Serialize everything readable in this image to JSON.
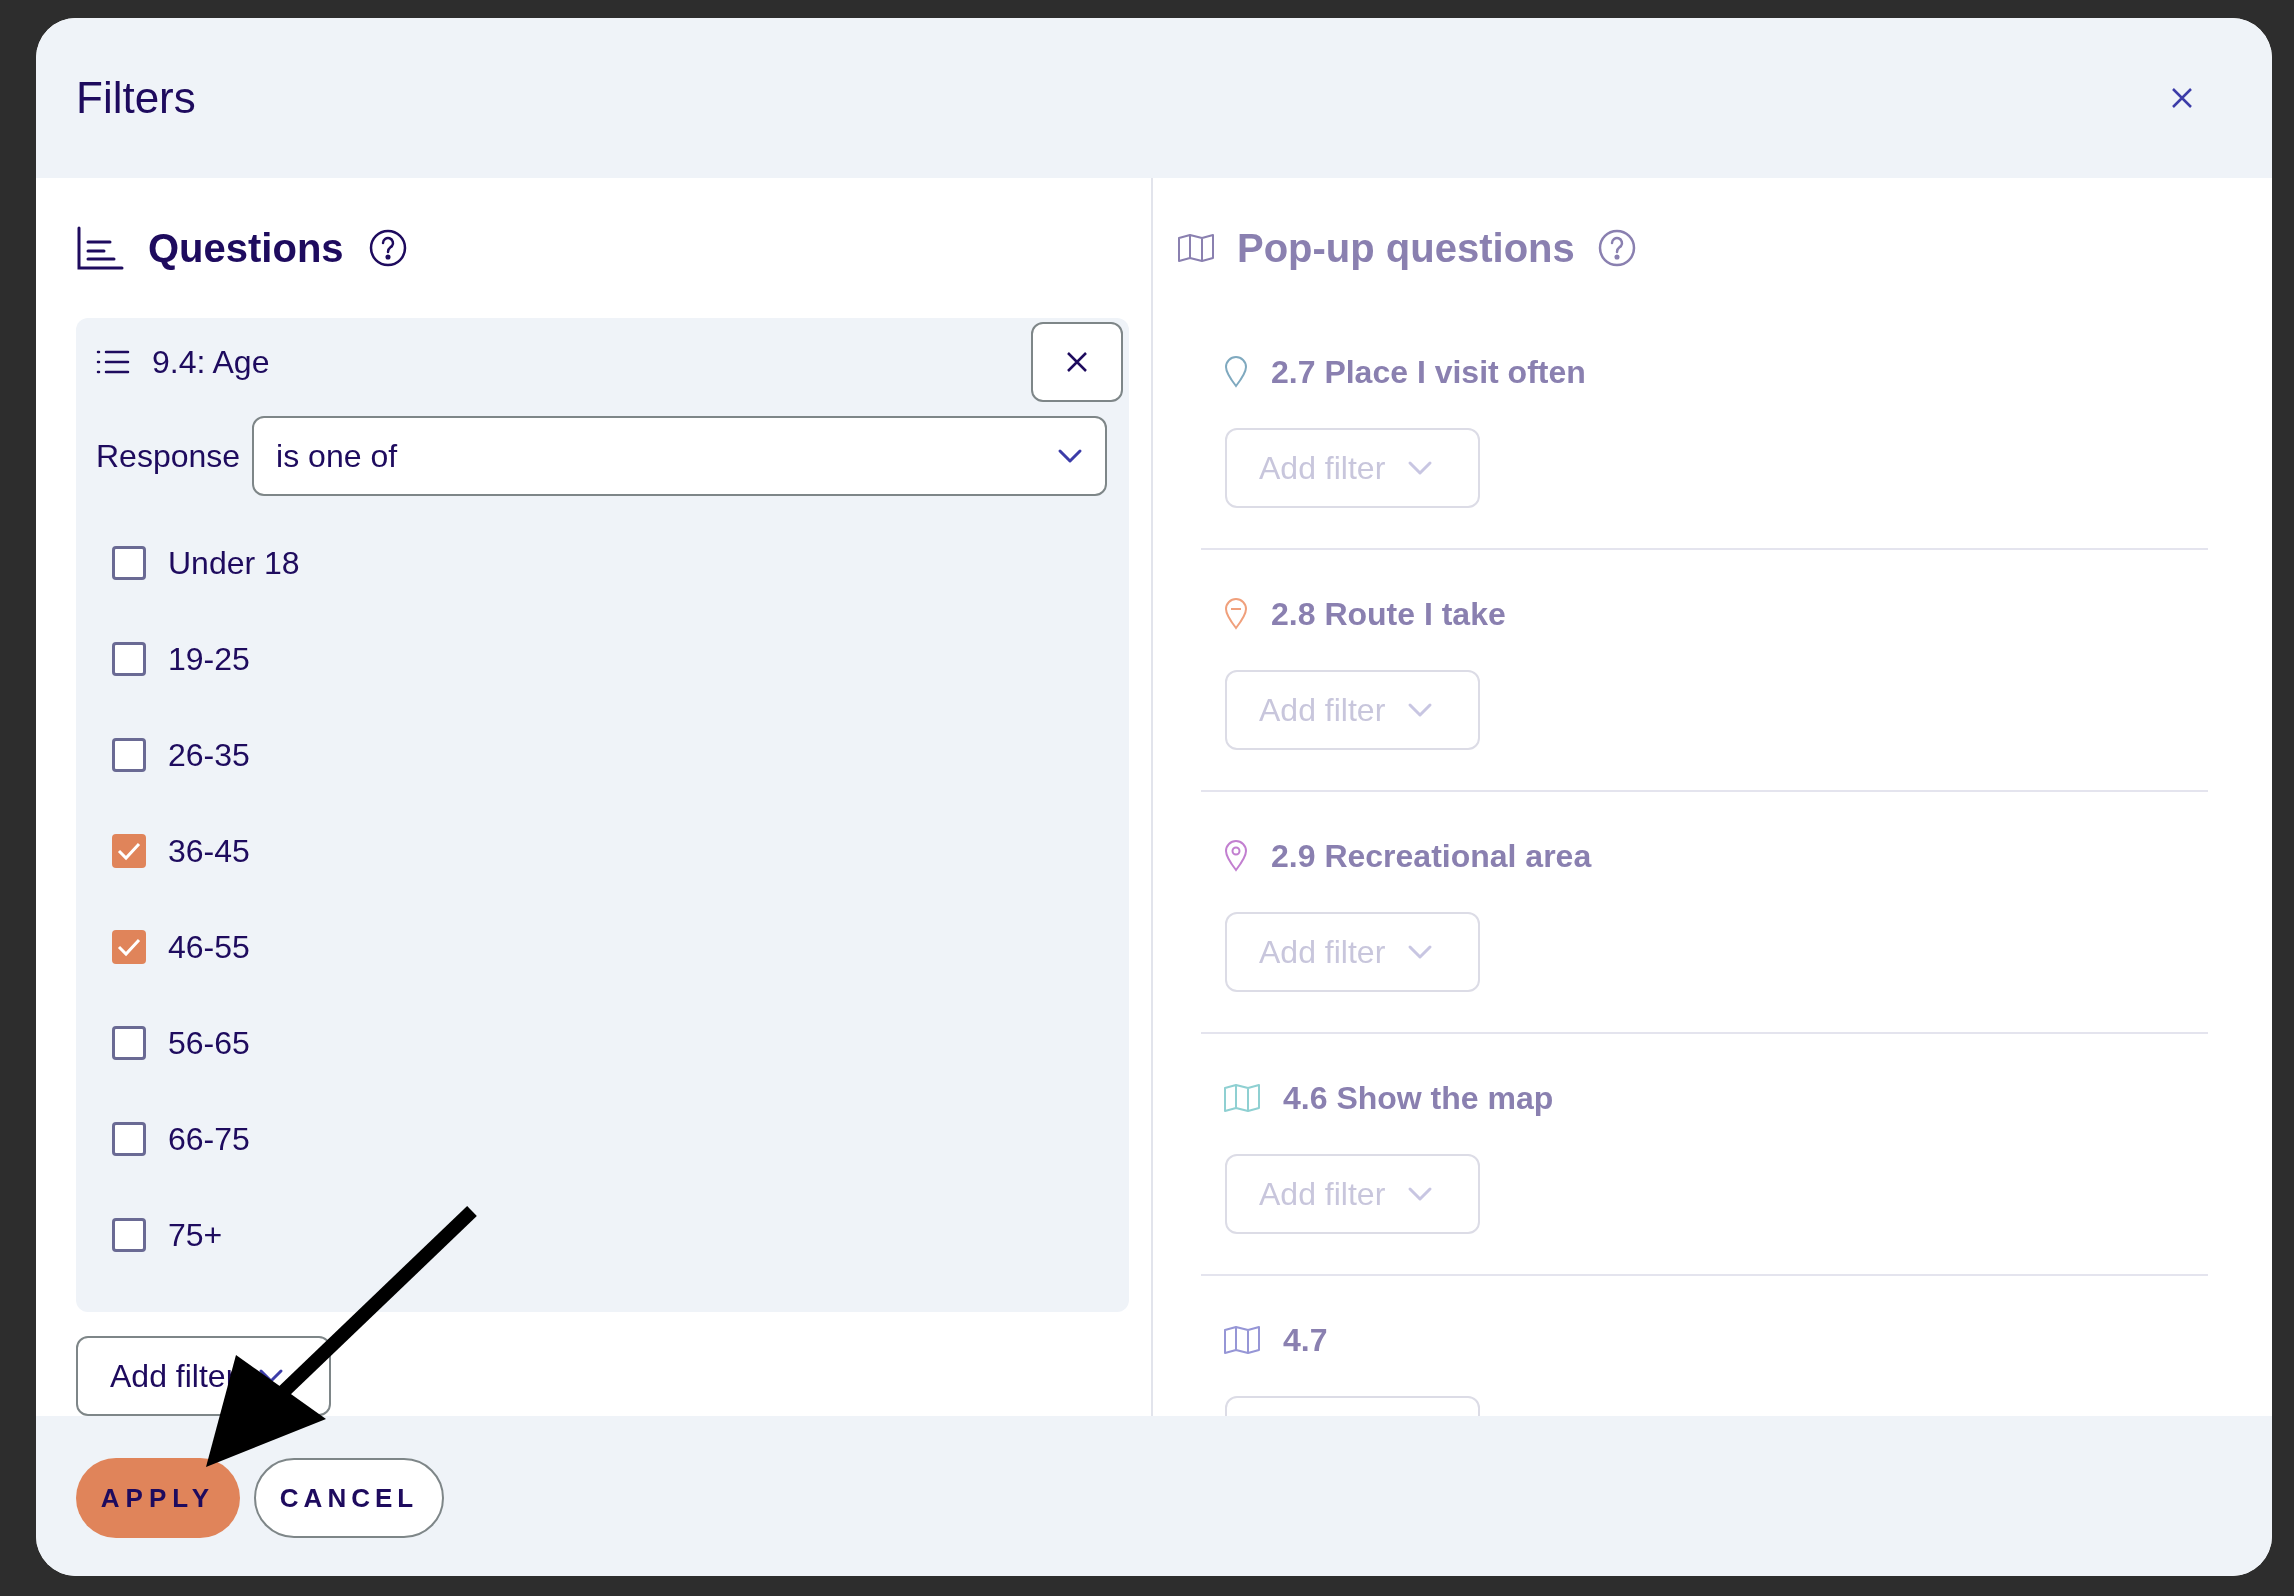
{
  "dialog": {
    "title": "Filters",
    "questions": {
      "heading": "Questions",
      "filter": {
        "question": "9.4: Age",
        "label": "Response",
        "operator": "is one of",
        "options": [
          {
            "label": "Under 18",
            "checked": false
          },
          {
            "label": "19-25",
            "checked": false
          },
          {
            "label": "26-35",
            "checked": false
          },
          {
            "label": "36-45",
            "checked": true
          },
          {
            "label": "46-55",
            "checked": true
          },
          {
            "label": "56-65",
            "checked": false
          },
          {
            "label": "66-75",
            "checked": false
          },
          {
            "label": "75+",
            "checked": false
          }
        ]
      },
      "add_filter": "Add filter"
    },
    "popup": {
      "heading": "Pop-up questions",
      "items": [
        {
          "kind": "pin",
          "color": "#7fa9bf",
          "title": "2.7 Place I visit often",
          "add_filter": "Add filter"
        },
        {
          "kind": "route",
          "color": "#f0a07c",
          "title": "2.8 Route I take",
          "add_filter": "Add filter"
        },
        {
          "kind": "point",
          "color": "#c27fd0",
          "title": "2.9 Recreational area",
          "add_filter": "Add filter"
        },
        {
          "kind": "map",
          "color": "#8fd0d2",
          "title": "4.6 Show the map",
          "add_filter": "Add filter"
        },
        {
          "kind": "map",
          "color": "#9696d6",
          "title": "4.7"
        }
      ]
    },
    "buttons": {
      "apply": "APPLY",
      "cancel": "CANCEL"
    }
  }
}
